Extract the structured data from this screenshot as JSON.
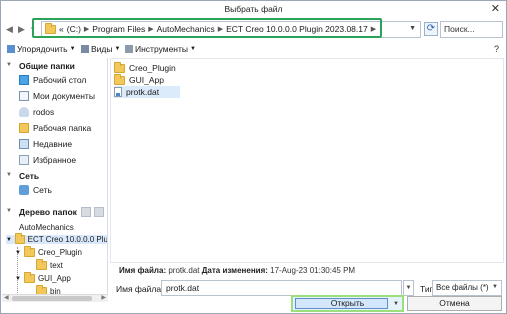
{
  "window": {
    "title": "Выбрать файл",
    "close_glyph": "✕"
  },
  "address": {
    "back_glyph": "◀",
    "forward_glyph": "▶",
    "recent_glyph": "▾",
    "overflow": "«",
    "crumbs": [
      "(C:)",
      "Program Files",
      "AutoMechanics",
      "ECT Creo 10.0.0.0 Plugin 2023.08.17"
    ],
    "search_placeholder": "Поиск..."
  },
  "toolbar": {
    "organize": "Упорядочить",
    "views": "Виды",
    "tools": "Инструменты",
    "help": "?"
  },
  "sidebar": {
    "favorites_header": "Общие папки",
    "favorites": [
      {
        "label": "Рабочий стол",
        "icon": "desktop-icon"
      },
      {
        "label": "Мои документы",
        "icon": "documents-icon"
      },
      {
        "label": "rodos",
        "icon": "user-icon"
      },
      {
        "label": "Рабочая папка",
        "icon": "working-folder-icon"
      },
      {
        "label": "Недавние",
        "icon": "recent-icon"
      },
      {
        "label": "Избранное",
        "icon": "favorites-icon"
      }
    ],
    "network_header": "Сеть",
    "network_item": "Сеть",
    "tree_header": "Дерево папок",
    "tree": [
      {
        "label": "AutoMechanics",
        "depth": 0
      },
      {
        "label": "ECT Creo 10.0.0.0 Plu",
        "depth": 0
      },
      {
        "label": "Creo_Plugin",
        "depth": 1
      },
      {
        "label": "text",
        "depth": 2
      },
      {
        "label": "GUI_App",
        "depth": 1
      },
      {
        "label": "bin",
        "depth": 2
      }
    ]
  },
  "files": [
    {
      "name": "Creo_Plugin",
      "kind": "folder"
    },
    {
      "name": "GUI_App",
      "kind": "folder"
    },
    {
      "name": "protk.dat",
      "kind": "file",
      "selected": true
    }
  ],
  "details": {
    "name_label": "Имя файла:",
    "name_value": "protk.dat",
    "modified_label": "Дата изменения:",
    "modified_value": "17-Aug-23 01:30:45 PM"
  },
  "footer": {
    "filename_label": "Имя файла:",
    "filename_value": "protk.dat",
    "type_label": "Тип",
    "type_value": "Все файлы (*)",
    "open_label": "Открыть",
    "cancel_label": "Отмена"
  },
  "colors": {
    "highlight": "#2aa25a",
    "open_highlight": "#9be07a",
    "selection": "#dcebfc"
  }
}
